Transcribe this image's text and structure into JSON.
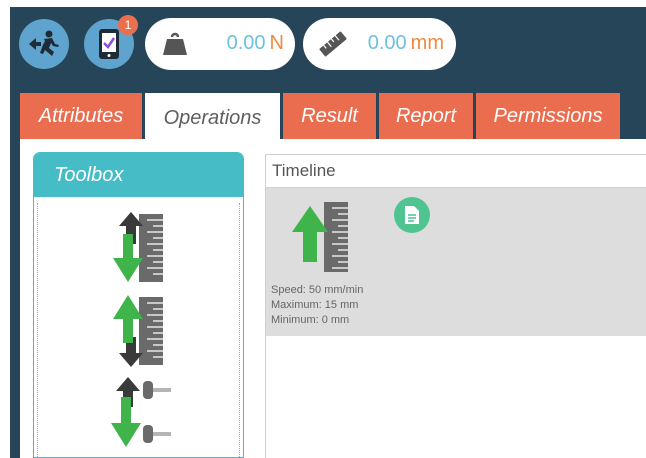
{
  "toolbar": {
    "notification_count": "1",
    "force": {
      "value": "0.00",
      "unit": "N"
    },
    "distance": {
      "value": "0.00",
      "unit": "mm"
    }
  },
  "tabs": [
    {
      "label": "Attributes",
      "active": false
    },
    {
      "label": "Operations",
      "active": true
    },
    {
      "label": "Result",
      "active": false
    },
    {
      "label": "Report",
      "active": false
    },
    {
      "label": "Permissions",
      "active": false
    }
  ],
  "toolbox": {
    "title": "Toolbox",
    "tools": [
      "move-up-down-ruler-icon",
      "move-down-up-ruler-icon",
      "move-gauge-icon"
    ]
  },
  "timeline": {
    "title": "Timeline",
    "steps": [
      {
        "icon": "move-up-ruler-icon",
        "speed": "Speed: 50 mm/min",
        "maximum": "Maximum: 15 mm",
        "minimum": "Minimum: 0 mm"
      }
    ]
  },
  "colors": {
    "header_bg": "#264558",
    "icon_btn": "#5fa3cf",
    "tab_orange": "#e96d4e",
    "toolbox_teal": "#46bcc6",
    "value_blue": "#6ec1dc",
    "unit_orange": "#f08a3c",
    "arrow_green": "#3eb44a",
    "doc_green": "#4fc491"
  }
}
